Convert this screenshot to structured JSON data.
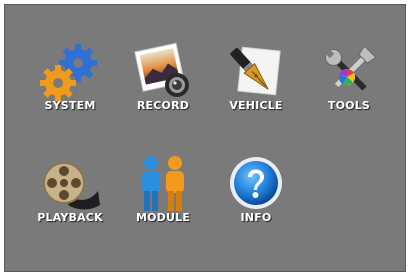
{
  "menu": {
    "items": [
      {
        "label": "SYSTEM",
        "icon": "gears-icon"
      },
      {
        "label": "RECORD",
        "icon": "photo-camera-icon"
      },
      {
        "label": "VEHICLE",
        "icon": "pen-nib-icon"
      },
      {
        "label": "TOOLS",
        "icon": "tools-icon"
      },
      {
        "label": "PLAYBACK",
        "icon": "film-reel-icon"
      },
      {
        "label": "MODULE",
        "icon": "users-icon"
      },
      {
        "label": "INFO",
        "icon": "help-icon"
      }
    ]
  },
  "colors": {
    "background": "#7a7a7a",
    "label": "#ffffff"
  }
}
